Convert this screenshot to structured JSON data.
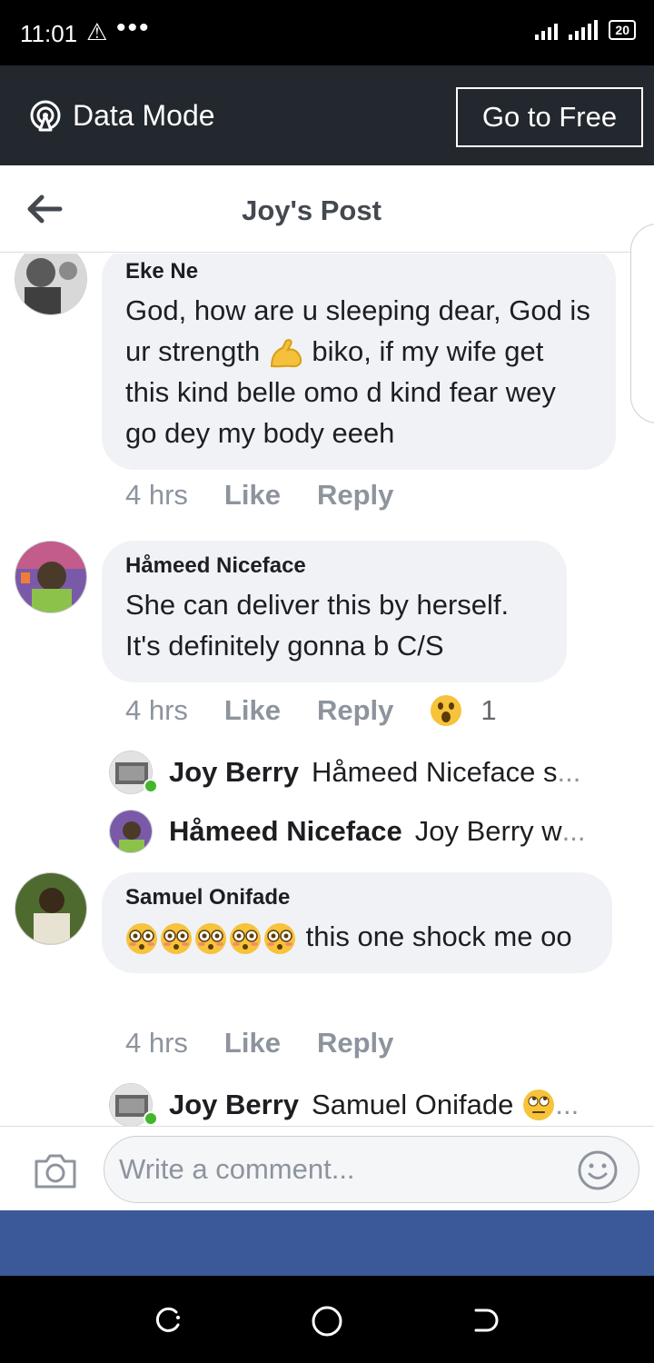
{
  "status_bar": {
    "time": "11:01",
    "alert_glyph": "⚠",
    "dots": "•••",
    "battery": "20"
  },
  "banner": {
    "data_mode_label": "Data Mode",
    "go_free_label": "Go to Free"
  },
  "nav": {
    "title": "Joy's Post"
  },
  "comments": [
    {
      "author": "Eke Ne",
      "text_before_emoji": "God, how are u sleeping dear, God is ur strength ",
      "emoji_icon": "flexed-biceps",
      "text_after_emoji": "  biko, if my wife get this kind belle omo d kind fear wey go dey my body eeeh",
      "time": "4 hrs",
      "like": "Like",
      "reply": "Reply"
    },
    {
      "author": "Håmeed Niceface",
      "text": "She can deliver this by herself. It's definitely gonna b C/S",
      "time": "4 hrs",
      "like": "Like",
      "reply": "Reply",
      "reaction_icon": "wow-face",
      "reaction_count": "1",
      "replies": [
        {
          "author": "Joy Berry",
          "text": "Håmeed Niceface s",
          "more": "..."
        },
        {
          "author": "Håmeed Niceface",
          "text": "Joy Berry w",
          "more": "..."
        }
      ]
    },
    {
      "author": "Samuel Onifade",
      "emoji_icon": "flushed-face",
      "emoji_count": 5,
      "text": "this one shock me oo",
      "time": "4 hrs",
      "like": "Like",
      "reply": "Reply",
      "replies": [
        {
          "author": "Joy Berry",
          "text": "Samuel Onifade",
          "emoji_icon": "rolling-eyes-face",
          "more": "..."
        }
      ]
    }
  ],
  "composer": {
    "placeholder": "Write a comment..."
  },
  "colors": {
    "status_bar": "#000000",
    "banner": "#23272e",
    "bubble": "#f0f2f5",
    "brand_blue": "#3b5998",
    "online": "#42b72a",
    "muted": "#8d949e"
  }
}
